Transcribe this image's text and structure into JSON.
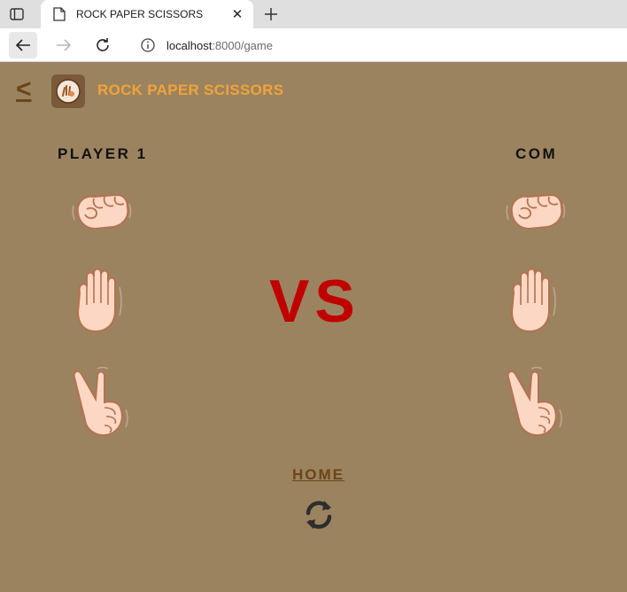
{
  "browser": {
    "tab_title": "ROCK PAPER SCISSORS",
    "url_host": "localhost",
    "url_path": ":8000/game"
  },
  "header": {
    "back_label": "<",
    "app_title": "ROCK PAPER SCISSORS"
  },
  "game": {
    "player_label": "PLAYER 1",
    "com_label": "COM",
    "vs_label": "VS",
    "player_choices": [
      "rock",
      "paper",
      "scissors"
    ],
    "com_choices": [
      "rock",
      "paper",
      "scissors"
    ]
  },
  "footer": {
    "home_label": "HOME"
  },
  "colors": {
    "background": "#9c8360",
    "title": "#f0a33a",
    "vs": "#c00000",
    "link": "#6a4518",
    "skin": "#fcd8c4",
    "skin_outline": "#b5714f"
  }
}
